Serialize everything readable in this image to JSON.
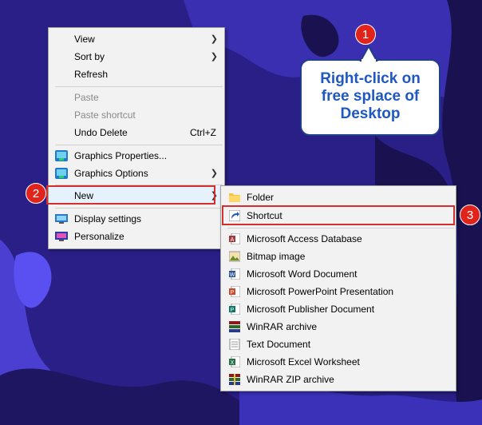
{
  "context_menu": {
    "items": [
      {
        "label": "View",
        "submenu": true
      },
      {
        "label": "Sort by",
        "submenu": true
      },
      {
        "label": "Refresh"
      },
      {
        "label": "Paste",
        "disabled": true
      },
      {
        "label": "Paste shortcut",
        "disabled": true
      },
      {
        "label": "Undo Delete",
        "shortcut": "Ctrl+Z"
      },
      {
        "label": "Graphics Properties...",
        "icon": "intel-graphics-icon"
      },
      {
        "label": "Graphics Options",
        "icon": "intel-graphics-icon",
        "submenu": true
      },
      {
        "label": "New",
        "submenu": true
      },
      {
        "label": "Display settings",
        "icon": "display-settings-icon"
      },
      {
        "label": "Personalize",
        "icon": "personalize-icon"
      }
    ]
  },
  "new_submenu": {
    "items": [
      {
        "label": "Folder",
        "icon": "folder-icon"
      },
      {
        "label": "Shortcut",
        "icon": "shortcut-icon"
      },
      {
        "label": "Microsoft Access Database",
        "icon": "access-icon"
      },
      {
        "label": "Bitmap image",
        "icon": "bitmap-icon"
      },
      {
        "label": "Microsoft Word Document",
        "icon": "word-icon"
      },
      {
        "label": "Microsoft PowerPoint Presentation",
        "icon": "powerpoint-icon"
      },
      {
        "label": "Microsoft Publisher Document",
        "icon": "publisher-icon"
      },
      {
        "label": "WinRAR archive",
        "icon": "winrar-icon"
      },
      {
        "label": "Text Document",
        "icon": "text-document-icon"
      },
      {
        "label": "Microsoft Excel Worksheet",
        "icon": "excel-icon"
      },
      {
        "label": "WinRAR ZIP archive",
        "icon": "winrar-zip-icon"
      }
    ]
  },
  "annotations": {
    "badges": [
      "1",
      "2",
      "3"
    ],
    "callout_lines": [
      "Right-click on",
      "free splace of",
      "Desktop"
    ]
  },
  "colors": {
    "desktop_bg": "#2d1f8a",
    "badge": "#e0241b",
    "highlight_box": "#d32f2f",
    "callout_text": "#1f58c0",
    "callout_border": "#1f3d8a"
  }
}
